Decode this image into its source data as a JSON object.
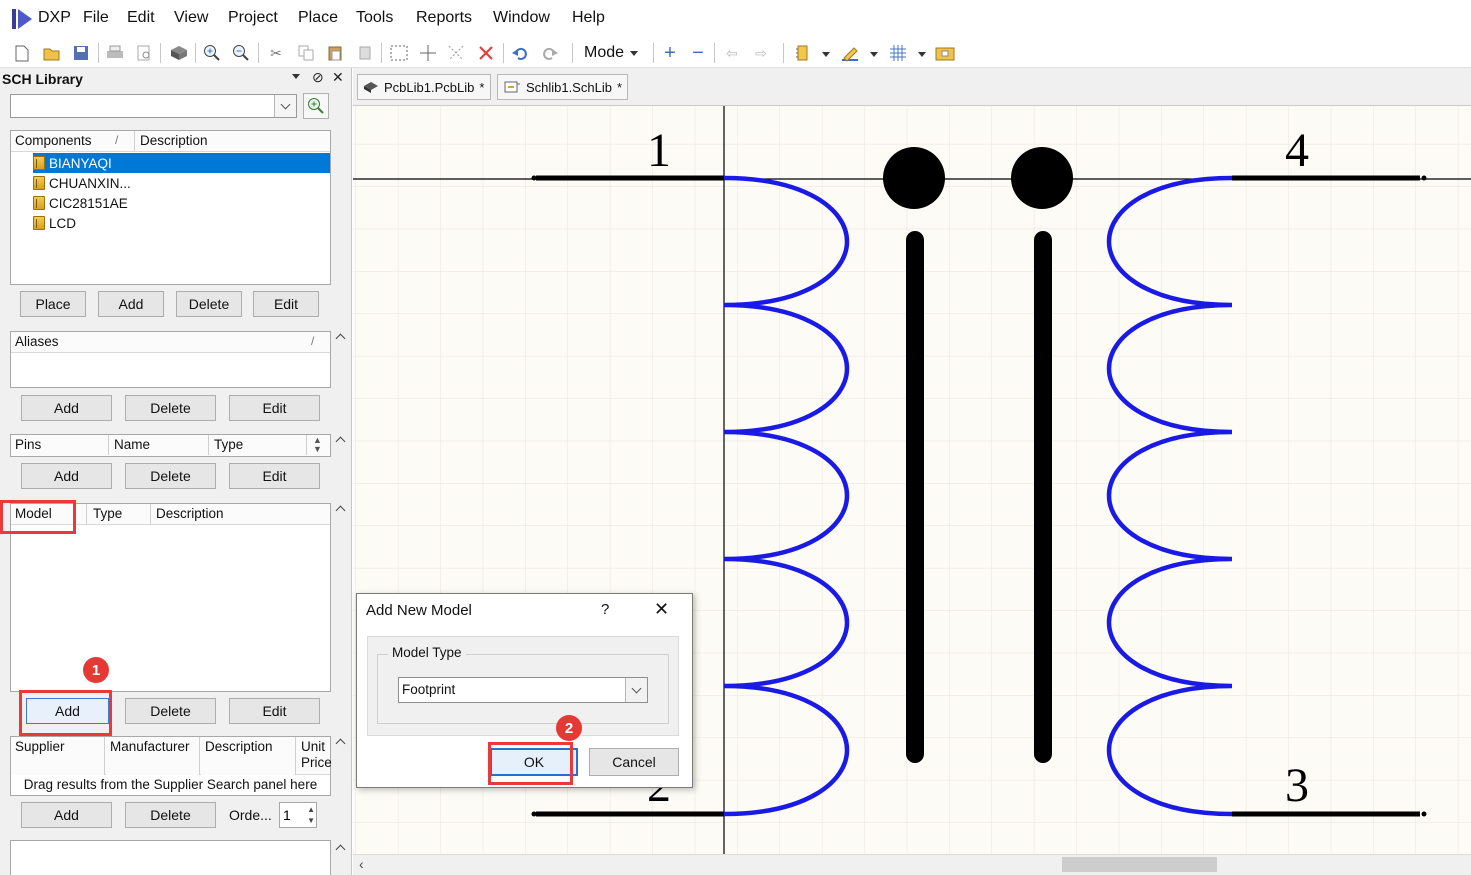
{
  "app": {
    "logo_label": "DXP",
    "menu": [
      "File",
      "Edit",
      "View",
      "Project",
      "Place",
      "Tools",
      "Reports",
      "Window",
      "Help"
    ]
  },
  "toolbar": {
    "mode_label": "Mode",
    "icons": [
      "new-icon",
      "open-icon",
      "save-icon",
      "print-icon",
      "print-preview-icon",
      "3d-icon",
      "zoom-in-icon",
      "zoom-out-icon",
      "cut-icon",
      "copy-icon",
      "paste-icon",
      "rubber-stamp-icon",
      "select-area-icon",
      "move-icon",
      "deselect-icon",
      "clear-filter-icon",
      "undo-icon",
      "redo-icon",
      "add-pin-icon",
      "remove-icon",
      "left-arrow-icon",
      "right-arrow-icon",
      "ieee-symbols-icon",
      "drawing-tools-icon",
      "grid-icon",
      "model-manager-icon"
    ]
  },
  "panel": {
    "title": "SCH Library",
    "search_value": "",
    "components": {
      "headers": [
        "Components",
        "Description"
      ],
      "sort_glyph": "/",
      "items": [
        {
          "name": "BIANYAQI",
          "selected": true
        },
        {
          "name": "CHUANXIN...",
          "selected": false
        },
        {
          "name": "CIC28151AE",
          "selected": false
        },
        {
          "name": "LCD",
          "selected": false
        }
      ],
      "buttons": [
        "Place",
        "Add",
        "Delete",
        "Edit"
      ]
    },
    "aliases": {
      "header": "Aliases",
      "sort_glyph": "/",
      "buttons": [
        "Add",
        "Delete",
        "Edit"
      ]
    },
    "pins": {
      "headers": [
        "Pins",
        "Name",
        "Type"
      ],
      "buttons": [
        "Add",
        "Delete",
        "Edit"
      ]
    },
    "model": {
      "headers": [
        "Model",
        "Type",
        "Description"
      ],
      "buttons": [
        "Add",
        "Delete",
        "Edit"
      ]
    },
    "supplier": {
      "headers": [
        "Supplier",
        "Manufacturer",
        "Description",
        "Unit",
        "Price"
      ],
      "hint": "Drag results from the Supplier Search panel here",
      "buttons": [
        "Add",
        "Delete"
      ],
      "order_label": "Orde...",
      "order_value": "1"
    }
  },
  "annotations": {
    "marker_1": "1",
    "marker_2": "2",
    "highlight_color": "#e83a3a"
  },
  "tabs": [
    {
      "label": "PcbLib1.PcbLib",
      "modified": "*"
    },
    {
      "label": "Schlib1.SchLib",
      "modified": "*"
    }
  ],
  "schematic": {
    "pin_numbers": [
      "1",
      "2",
      "3",
      "4"
    ],
    "coil_color": "#1a1ae6",
    "pin_color": "#000000",
    "background": "#fdfbf5"
  },
  "dialog": {
    "title": "Add New Model",
    "help": "?",
    "close": "✕",
    "group_label": "Model Type",
    "selected_type": "Footprint",
    "ok_label": "OK",
    "cancel_label": "Cancel"
  }
}
